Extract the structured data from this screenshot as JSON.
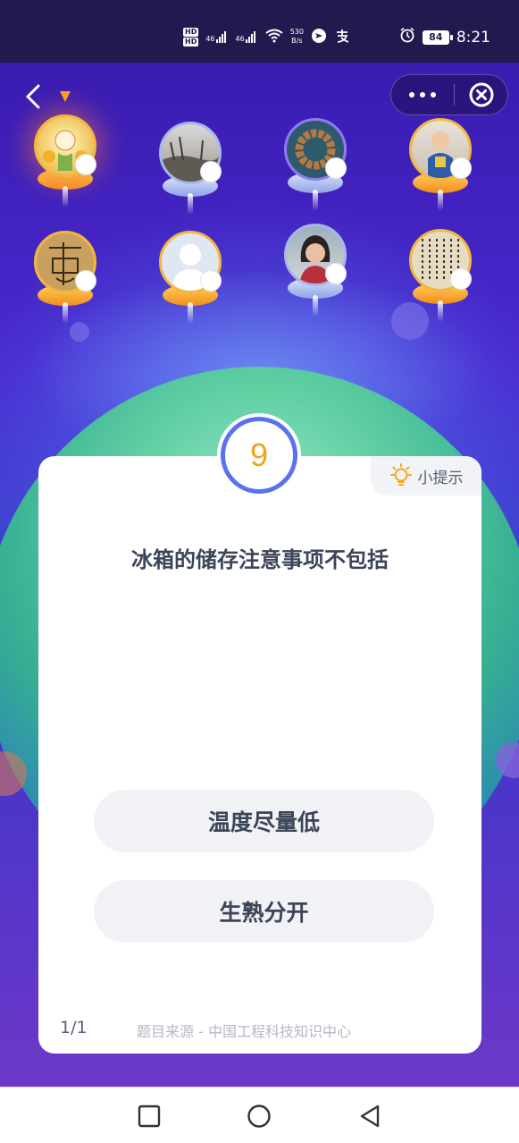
{
  "status_bar": {
    "hd_labels": [
      "HD",
      "HD"
    ],
    "signal_1": "46",
    "signal_2": "46",
    "net_speed": "530",
    "net_unit": "B/s",
    "battery": "84",
    "time": "8:21",
    "icons": [
      "alarm-icon",
      "wifi-icon",
      "alipay-icon",
      "nav-app-icon"
    ]
  },
  "controls": {
    "back_icon": "chevron-left-icon",
    "more_icon": "more-dots-icon",
    "close_icon": "close-circle-icon"
  },
  "players": [
    {
      "name": "player-1",
      "avatar": "sunflower-boy",
      "current": true
    },
    {
      "name": "player-2",
      "avatar": "winter-landscape"
    },
    {
      "name": "player-3",
      "avatar": "prayer-beads"
    },
    {
      "name": "player-4",
      "avatar": "child-photo"
    },
    {
      "name": "player-5",
      "avatar": "calligraphy-seal"
    },
    {
      "name": "player-6",
      "avatar": "default-silhouette"
    },
    {
      "name": "player-7",
      "avatar": "woman-portrait"
    },
    {
      "name": "player-8",
      "avatar": "calligraphy-text"
    }
  ],
  "question": {
    "number": "9",
    "hint_label": "小提示",
    "text": "冰箱的储存注意事项不包括",
    "options": [
      "温度尽量低",
      "生熟分开"
    ],
    "progress": "1/1",
    "source": "题目来源 - 中国工程科技知识中心"
  },
  "colors": {
    "accent_blue": "#5b72f0",
    "number_orange": "#f2a217",
    "background_purple": "#3a1bb0"
  },
  "navbar": {
    "icons": [
      "square-recent-icon",
      "circle-home-icon",
      "triangle-back-icon"
    ]
  }
}
